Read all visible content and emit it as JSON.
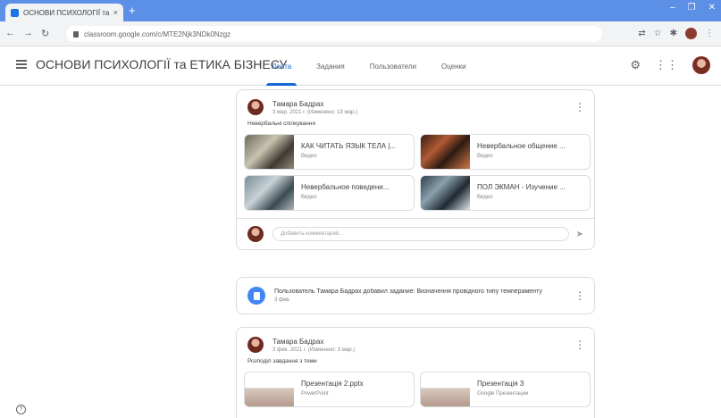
{
  "browser": {
    "tab_title": "ОСНОВИ ПСИХОЛОГІЇ та ЕТИКА",
    "tab_close": "×",
    "new_tab": "+",
    "url": "classroom.google.com/c/MTE2Njk3NDk0Nzgz"
  },
  "app": {
    "class_name": "ОСНОВИ ПСИХОЛОГІЇ та ЕТИКА БІЗНЕСУ",
    "tabs": [
      {
        "label": "Лента"
      },
      {
        "label": "Задания"
      },
      {
        "label": "Пользователи"
      },
      {
        "label": "Оценки"
      }
    ]
  },
  "posts": [
    {
      "author": "Тамара Бадрах",
      "date": "3 мар. 2021 г. (Изменено: 13 мар.)",
      "text": "Невербальні спілкування",
      "attachments": [
        {
          "title": "КАК ЧИТАТЬ ЯЗЫК ТЕЛА |...",
          "type": "Видео"
        },
        {
          "title": "Невербальное общение ...",
          "type": "Видео"
        },
        {
          "title": "Невербальное поведени...",
          "type": "Видео"
        },
        {
          "title": "ПОЛ ЭКМАН - Изучение ...",
          "type": "Видео"
        }
      ]
    }
  ],
  "comment": {
    "placeholder": "Добавить комментарий..."
  },
  "notice": {
    "text": "Пользователь Тамара Бадрах добавил задание: Визначення провідного типу темпераменту",
    "date": "3 фев."
  },
  "post2": {
    "author": "Тамара Бадрах",
    "date": "3 фев. 2021 г. (Изменено: 3 мар.)",
    "text": "Розподіл завдання з теми",
    "attachments": [
      {
        "title": "Презентація 2.pptx",
        "type": "PowerPoint"
      },
      {
        "title": "Презентація 3",
        "type": "Google Презентации"
      }
    ]
  },
  "colors": {
    "chrome_tabstrip": "#5c8fe6",
    "active_tab": "#1967d2",
    "notice_icon": "#4285f4"
  }
}
